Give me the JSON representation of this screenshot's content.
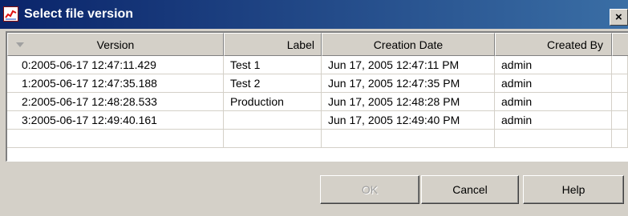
{
  "window": {
    "title": "Select file version"
  },
  "columns": [
    {
      "label": "Version"
    },
    {
      "label": "Label"
    },
    {
      "label": "Creation Date"
    },
    {
      "label": "Created By"
    }
  ],
  "rows": [
    {
      "version": "0:2005-06-17 12:47:11.429",
      "label": "Test 1",
      "creation_date": "Jun 17, 2005 12:47:11 PM",
      "created_by": "admin"
    },
    {
      "version": "1:2005-06-17 12:47:35.188",
      "label": "Test 2",
      "creation_date": "Jun 17, 2005 12:47:35 PM",
      "created_by": "admin"
    },
    {
      "version": "2:2005-06-17 12:48:28.533",
      "label": "Production",
      "creation_date": "Jun 17, 2005 12:48:28 PM",
      "created_by": "admin"
    },
    {
      "version": "3:2005-06-17 12:49:40.161",
      "label": "",
      "creation_date": "Jun 17, 2005 12:49:40 PM",
      "created_by": "admin"
    }
  ],
  "buttons": {
    "ok": "OK",
    "cancel": "Cancel",
    "help": "Help"
  },
  "colors": {
    "titlebar_start": "#0a246a",
    "titlebar_end": "#3a6ea5",
    "dialog_bg": "#d4d0c8"
  },
  "icons": {
    "title": "chart-icon",
    "close": "close-icon",
    "sort": "sort-arrow-icon"
  }
}
